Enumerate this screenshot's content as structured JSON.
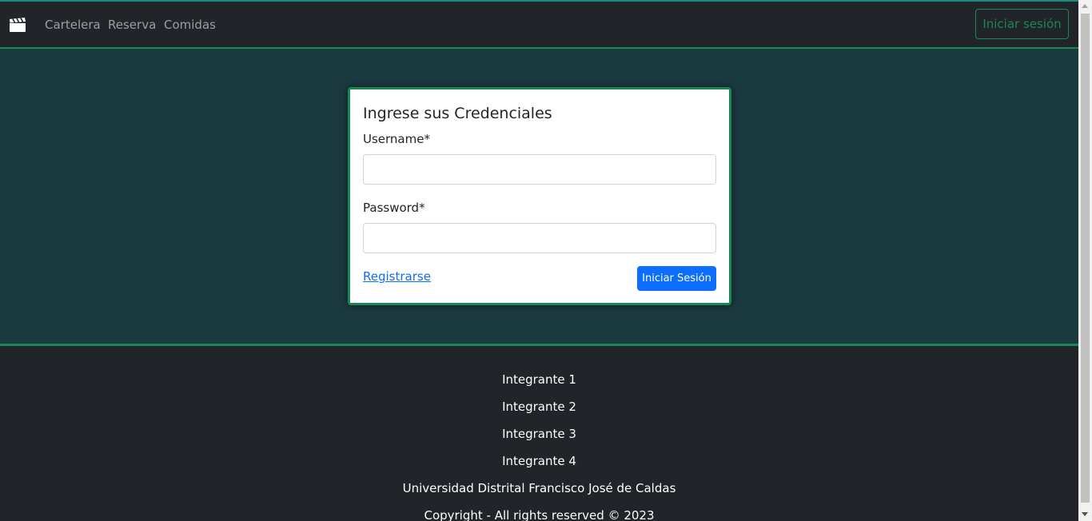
{
  "navbar": {
    "brand_icon": "clapperboard-icon",
    "links": [
      {
        "label": "Cartelera"
      },
      {
        "label": "Reserva"
      },
      {
        "label": "Comidas"
      }
    ],
    "login_button": "Iniciar sesión"
  },
  "login_card": {
    "title": "Ingrese sus Credenciales",
    "username_label": "Username*",
    "username_value": "",
    "password_label": "Password*",
    "password_value": "",
    "register_link": "Registrarse",
    "submit_button": "Iniciar Sesión"
  },
  "footer": {
    "members": [
      "Integrante 1",
      "Integrante 2",
      "Integrante 3",
      "Integrante 4"
    ],
    "university": "Universidad Distrital Francisco José de Caldas",
    "copyright": "Copyright - All rights reserved © 2023"
  },
  "colors": {
    "accent_green": "#198754",
    "primary_blue": "#0d6efd",
    "dark_bg": "#212529",
    "main_bg": "#1b3a40"
  }
}
